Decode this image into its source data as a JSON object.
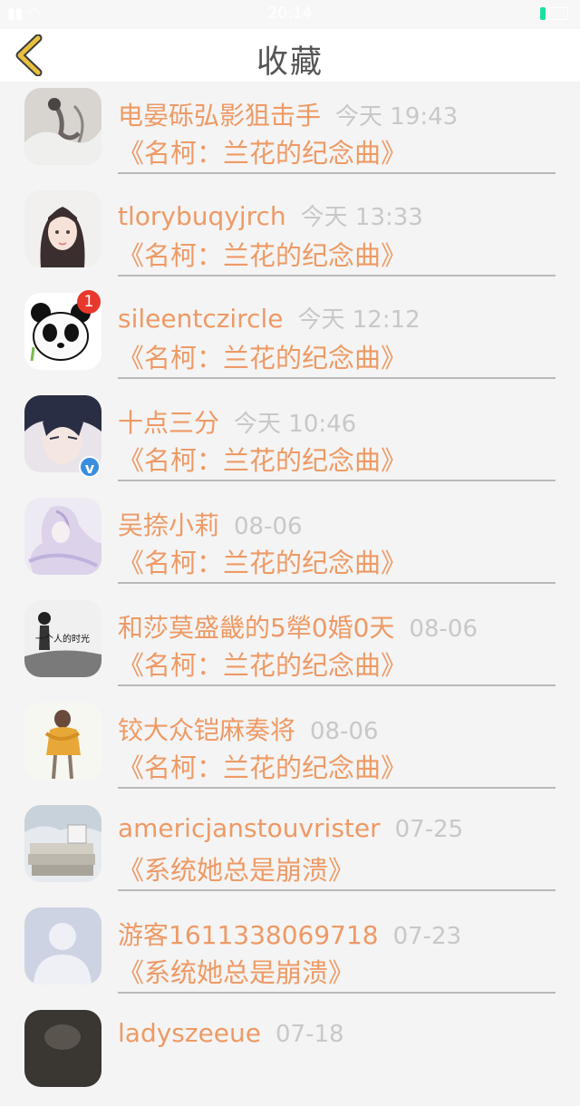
{
  "status_bar": {
    "time": "20:14",
    "signal_icon": "signal-wifi-icon",
    "battery_icon": "battery-icon",
    "battery_color": "#19e0a0"
  },
  "header": {
    "title": "收藏",
    "back_icon": "chevron-left-icon",
    "back_color": "#e0b020"
  },
  "colors": {
    "accent": "#ee9a65",
    "time": "#c8c8c8",
    "title": "#555555"
  },
  "items": [
    {
      "name": "电晏砾弘影狙击手",
      "time": "今天 19:43",
      "work": "《名柯：兰花的纪念曲》",
      "avatar": "avatar-ink-dancer"
    },
    {
      "name": "tlorybuqyjrch",
      "time": "今天 13:33",
      "work": "《名柯：兰花的纪念曲》",
      "avatar": "avatar-girl-portrait"
    },
    {
      "name": "sileentczircle",
      "time": "今天 12:12",
      "work": "《名柯：兰花的纪念曲》",
      "avatar": "avatar-panda",
      "badge": "1"
    },
    {
      "name": "十点三分",
      "time": "今天 10:46",
      "work": "《名柯：兰花的纪念曲》",
      "avatar": "avatar-anime-boy",
      "verified_icon": "verified-v-icon"
    },
    {
      "name": "吴捺小莉",
      "time": "08-06",
      "work": "《名柯：兰花的纪念曲》",
      "avatar": "avatar-white-hair"
    },
    {
      "name": "和莎莫盛畿的5犖0婚0天",
      "time": "08-06",
      "work": "《名柯：兰花的纪念曲》",
      "avatar": "avatar-bw-figure",
      "avatar_text": "一个人的时光"
    },
    {
      "name": "铰大众铠麻奏将",
      "time": "08-06",
      "work": "《名柯：兰花的纪念曲》",
      "avatar": "avatar-scarf-figure"
    },
    {
      "name": "americjanstouvrister",
      "time": "07-25",
      "work": "《系统她总是崩溃》",
      "avatar": "avatar-books-snow"
    },
    {
      "name": "游客1611338069718",
      "time": "07-23",
      "work": "《系统她总是崩溃》",
      "avatar": "avatar-default-user"
    },
    {
      "name": "ladyszeeue",
      "time": "07-18",
      "work": "",
      "avatar": "avatar-dark"
    }
  ]
}
